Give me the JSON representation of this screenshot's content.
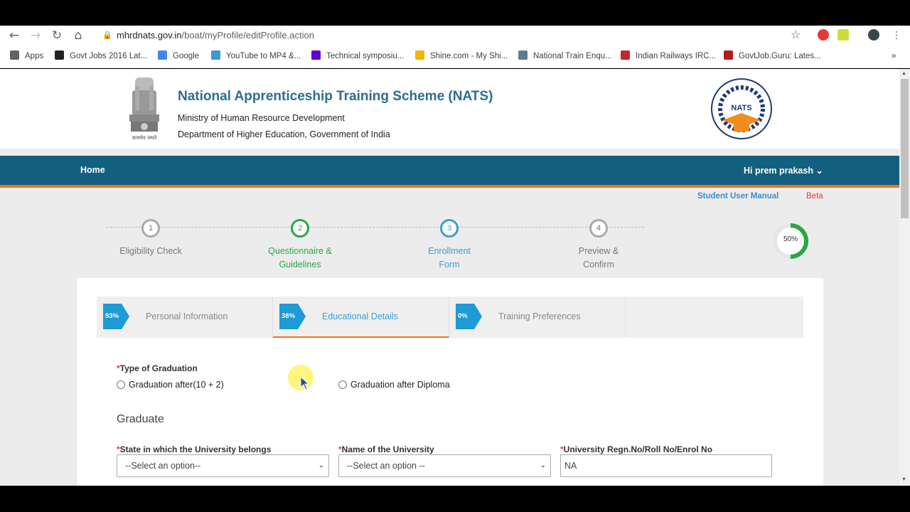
{
  "browser": {
    "url_host": "mhrdnats.gov.in",
    "url_path": "/boat/myProfile/editProfile.action",
    "bookmarks": [
      {
        "label": "Apps",
        "color": "#5f6368"
      },
      {
        "label": "Govt Jobs 2016 Lat...",
        "color": "#222222"
      },
      {
        "label": "Google",
        "color": "#4285f4"
      },
      {
        "label": "YouTube to MP4 &...",
        "color": "#3d9ad1"
      },
      {
        "label": "Technical symposiu...",
        "color": "#6001d2"
      },
      {
        "label": "Shine.com - My Shi...",
        "color": "#f4b400"
      },
      {
        "label": "National Train Enqu...",
        "color": "#607d8b"
      },
      {
        "label": "Indian Railways IRC...",
        "color": "#c62828"
      },
      {
        "label": "GovtJob.Guru: Lates...",
        "color": "#b71c1c"
      }
    ],
    "overflow_label": "»"
  },
  "header": {
    "title": "National Apprenticeship Training Scheme (NATS)",
    "ministry": "Ministry of Human Resource Development",
    "department": "Department of Higher Education, Government of India",
    "emblem_caption": "सत्यमेव जयते",
    "logo_text": "NATS"
  },
  "nav": {
    "home": "Home",
    "user": "Hi prem prakash ⌄"
  },
  "links": {
    "manual": "Student User Manual",
    "beta": "Beta"
  },
  "steps": [
    {
      "number": "1",
      "label": "Eligibility Check",
      "color": "#aaaaaa"
    },
    {
      "number": "2",
      "label": "Questionnaire & Guidelines",
      "color": "#27a844"
    },
    {
      "number": "3",
      "label": "Enrollment Form",
      "color": "#3aa0d0"
    },
    {
      "number": "4",
      "label": "Preview & Confirm",
      "color": "#aaaaaa"
    }
  ],
  "overall_progress": {
    "label": "50%",
    "fraction": 0.5,
    "color": "#27a844"
  },
  "tabs": [
    {
      "pct": "93%",
      "label": "Personal Information"
    },
    {
      "pct": "38%",
      "label": "Educational Details"
    },
    {
      "pct": "0%",
      "label": "Training Preferences"
    }
  ],
  "form": {
    "graduation_type_label": "Type of Graduation",
    "option_1": "Graduation after(10 + 2)",
    "option_2": "Graduation after Diploma",
    "section_title": "Graduate",
    "state_label": "State in which the University belongs",
    "state_value": "--Select an option--",
    "university_label": "Name of the University",
    "university_value": "--Select an option --",
    "regn_label": "University Regn.No/Roll No/Enrol No",
    "regn_value": "NA"
  },
  "colors": {
    "navbar": "#13607e",
    "accent_orange": "#f26f21",
    "title_blue": "#2c6e8e",
    "tab_arrow": "#1e9ad6"
  }
}
